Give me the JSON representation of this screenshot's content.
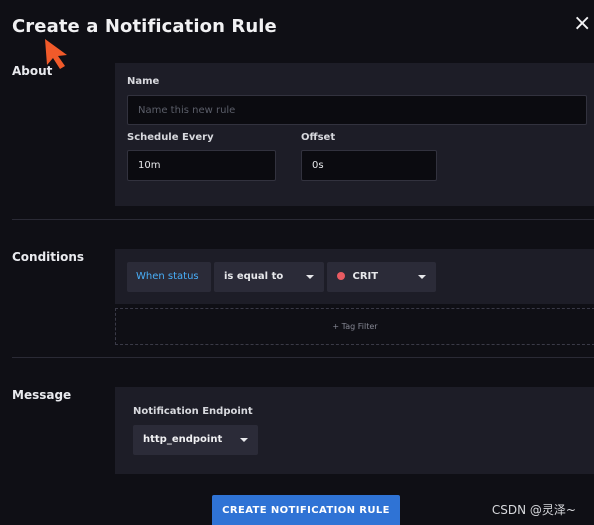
{
  "header": {
    "title": "Create a Notification Rule",
    "close_icon": "close-icon"
  },
  "about": {
    "section_label": "About",
    "name_label": "Name",
    "name_placeholder": "Name this new rule",
    "schedule_label": "Schedule Every",
    "schedule_value": "10m",
    "offset_label": "Offset",
    "offset_value": "0s"
  },
  "conditions": {
    "section_label": "Conditions",
    "when_label": "When status",
    "operator_label": "is equal to",
    "status_label": "CRIT",
    "status_color": "#e85b62",
    "tag_filter_label": "+ Tag Filter"
  },
  "message": {
    "section_label": "Message",
    "endpoint_label": "Notification Endpoint",
    "endpoint_value": "http_endpoint"
  },
  "footer": {
    "create_button_label": "CREATE NOTIFICATION RULE",
    "watermark": "CSDN @灵泽~"
  },
  "colors": {
    "background": "#0f0f15",
    "panel": "#1d1d27",
    "accent_blue": "#48aef8",
    "button_blue": "#2f73d5"
  }
}
